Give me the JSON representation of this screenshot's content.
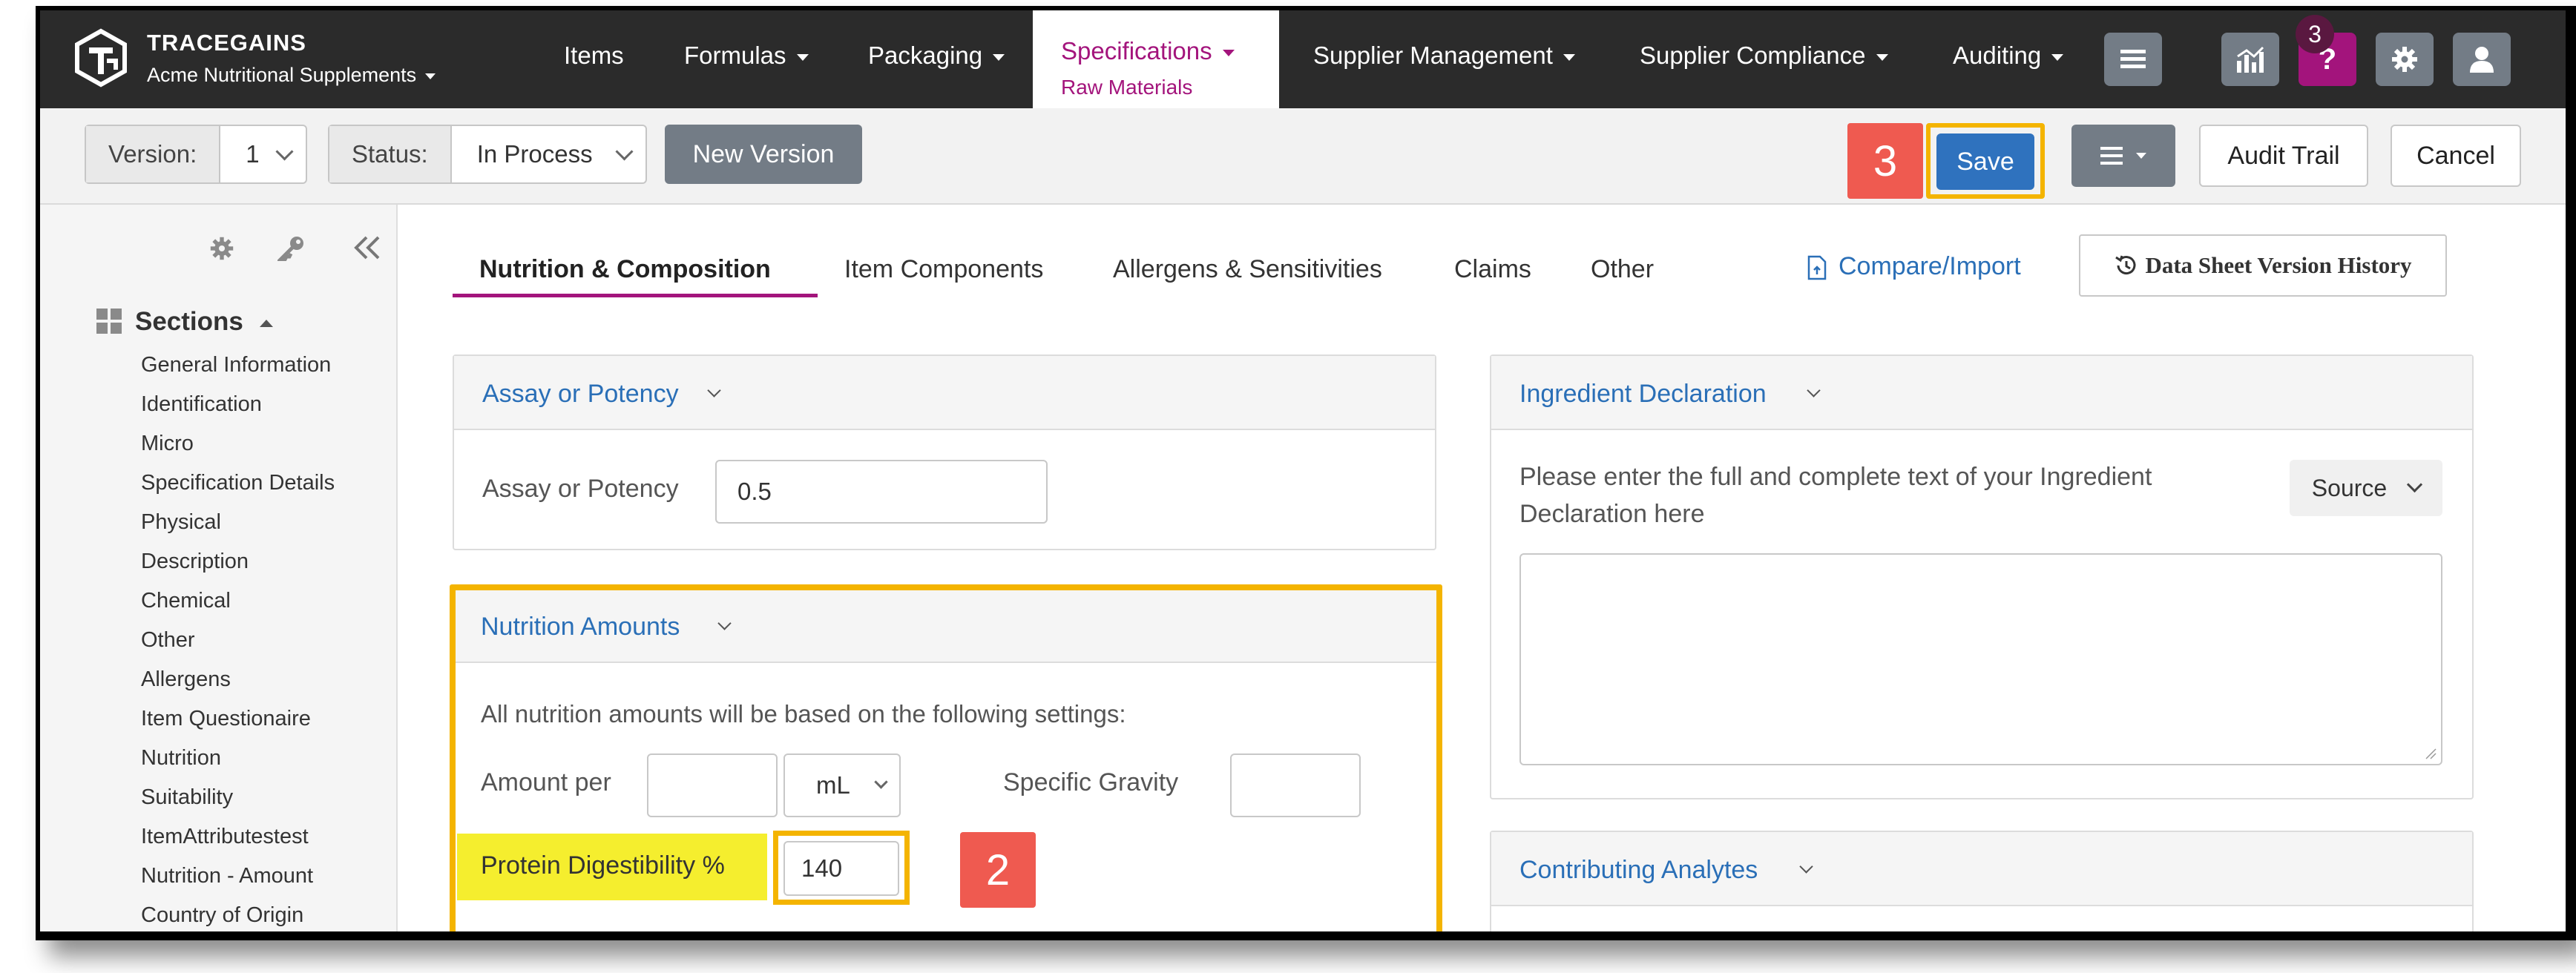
{
  "app": {
    "brand": "TRACEGAINS",
    "tenant": "Acme Nutritional Supplements"
  },
  "nav": {
    "items": [
      "Items",
      "Formulas",
      "Packaging",
      "Specifications",
      "Supplier Management",
      "Supplier Compliance",
      "Auditing"
    ],
    "active_sub": "Raw Materials",
    "notification_count": "3",
    "icons": [
      "menu-icon",
      "analytics-icon",
      "help-icon",
      "gear-icon",
      "user-icon"
    ]
  },
  "toolbar": {
    "version_label": "Version:",
    "version_value": "1",
    "status_label": "Status:",
    "status_value": "In Process",
    "new_version": "New Version",
    "save": "Save",
    "audit_trail": "Audit Trail",
    "cancel": "Cancel"
  },
  "sidebar": {
    "sections_title": "Sections",
    "items": [
      "General Information",
      "Identification",
      "Micro",
      "Specification Details",
      "Physical",
      "Description",
      "Chemical",
      "Other",
      "Allergens",
      "Item Questionaire",
      "Nutrition",
      "Suitability",
      "ItemAttributestest",
      "Nutrition - Amount",
      "Country of Origin"
    ]
  },
  "tabs": {
    "items": [
      "Nutrition & Composition",
      "Item Components",
      "Allergens & Sensitivities",
      "Claims",
      "Other"
    ],
    "active": "Nutrition & Composition",
    "compare_import": "Compare/Import",
    "version_history": "Data Sheet Version History"
  },
  "assay": {
    "title": "Assay or Potency",
    "field_label": "Assay or Potency",
    "field_value": "0.5"
  },
  "nutrition": {
    "title": "Nutrition Amounts",
    "note": "All nutrition amounts will be based on the following settings:",
    "amount_per_label": "Amount per",
    "amount_per_value": "",
    "unit_value": "mL",
    "specific_gravity_label": "Specific Gravity",
    "specific_gravity_value": "",
    "protein_label": "Protein Digestibility %",
    "protein_value": "140"
  },
  "ingredient": {
    "title": "Ingredient Declaration",
    "prompt": "Please enter the full and complete text of your Ingredient Declaration here",
    "source_label": "Source"
  },
  "analytes": {
    "title": "Contributing Analytes"
  },
  "callouts": {
    "step_save": "3",
    "step_protein": "2"
  },
  "colors": {
    "nav_bg": "#2b2b2b",
    "accent_magenta": "#a3147c",
    "link_blue": "#2a6fb7",
    "save_blue": "#2f72be",
    "highlight_yellow": "#f5ee2e",
    "callout_border": "#f4b400",
    "callout_red": "#ef5a50"
  }
}
